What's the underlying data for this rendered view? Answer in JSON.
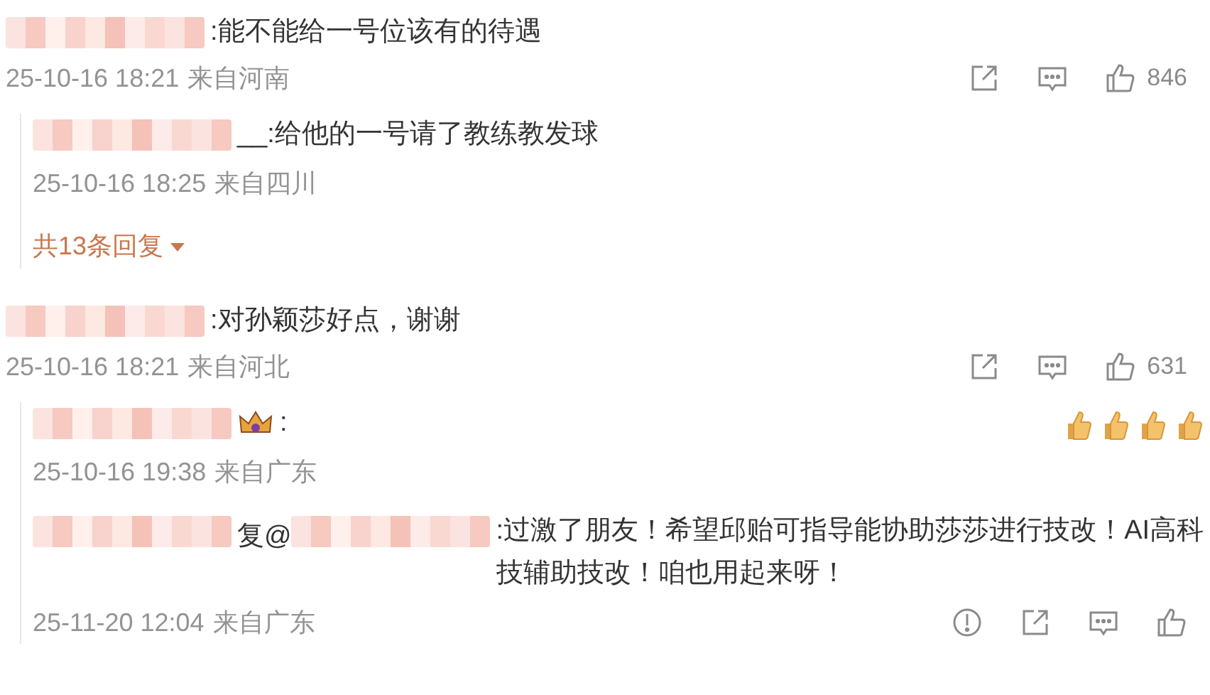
{
  "comments": [
    {
      "content": [
        {
          "kind": "mosaic"
        },
        {
          "kind": "text",
          "text": ":能不能给一号位该有的待遇"
        }
      ],
      "time": "25-10-16 18:21",
      "location": "来自河南",
      "actions": [
        {
          "kind": "share"
        },
        {
          "kind": "comment"
        },
        {
          "kind": "like",
          "count": "846"
        }
      ],
      "replies": [
        {
          "content": [
            {
              "kind": "mosaic"
            },
            {
              "kind": "text",
              "text": "__:给他的一号请了教练教发球"
            }
          ],
          "time": "25-10-16 18:25",
          "location": "来自四川"
        }
      ],
      "more_replies": "共13条回复"
    },
    {
      "content": [
        {
          "kind": "mosaic"
        },
        {
          "kind": "text",
          "text": ":对孙颖莎好点，谢谢"
        }
      ],
      "time": "25-10-16 18:21",
      "location": "来自河北",
      "actions": [
        {
          "kind": "share"
        },
        {
          "kind": "comment"
        },
        {
          "kind": "like",
          "count": "631"
        }
      ],
      "replies": [
        {
          "content": [
            {
              "kind": "mosaic"
            },
            {
              "kind": "crown"
            },
            {
              "kind": "text",
              "text": ":"
            },
            {
              "kind": "thumbs"
            },
            {
              "kind": "thumbs"
            },
            {
              "kind": "thumbs"
            },
            {
              "kind": "thumbs"
            }
          ],
          "time": "25-10-16 19:38",
          "location": "来自广东"
        },
        {
          "content": [
            {
              "kind": "mosaic"
            },
            {
              "kind": "text",
              "text": "复"
            },
            {
              "kind": "text",
              "text": "@"
            },
            {
              "kind": "mosaic"
            },
            {
              "kind": "text",
              "text": ":过激了朋友！希望邱贻可指导能协助莎莎进行技改！AI高科技辅助技改！咱也用起来呀！"
            }
          ],
          "time": "25-11-20 12:04",
          "location": "来自广东",
          "actions": [
            {
              "kind": "report"
            },
            {
              "kind": "share"
            },
            {
              "kind": "comment"
            },
            {
              "kind": "like"
            }
          ]
        }
      ]
    }
  ]
}
